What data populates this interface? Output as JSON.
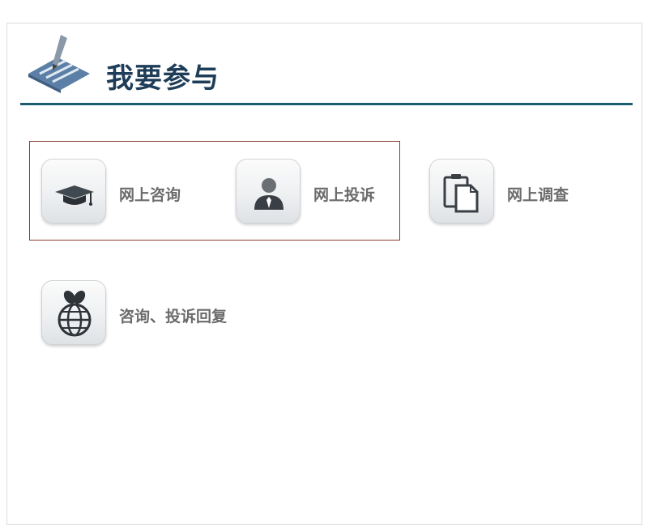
{
  "header": {
    "icon": "pen-writing-icon",
    "title": "我要参与"
  },
  "items": [
    {
      "label": "网上咨询",
      "icon": "graduation-cap-icon"
    },
    {
      "label": "网上投诉",
      "icon": "person-icon"
    },
    {
      "label": "网上调查",
      "icon": "clipboard-icon"
    },
    {
      "label": "咨询、投诉回复",
      "icon": "globe-icon"
    }
  ],
  "colors": {
    "title": "#1e3d58",
    "header_line": "#1b5c6e",
    "highlight_border": "#8b3a35",
    "label": "#6b6b6b"
  }
}
